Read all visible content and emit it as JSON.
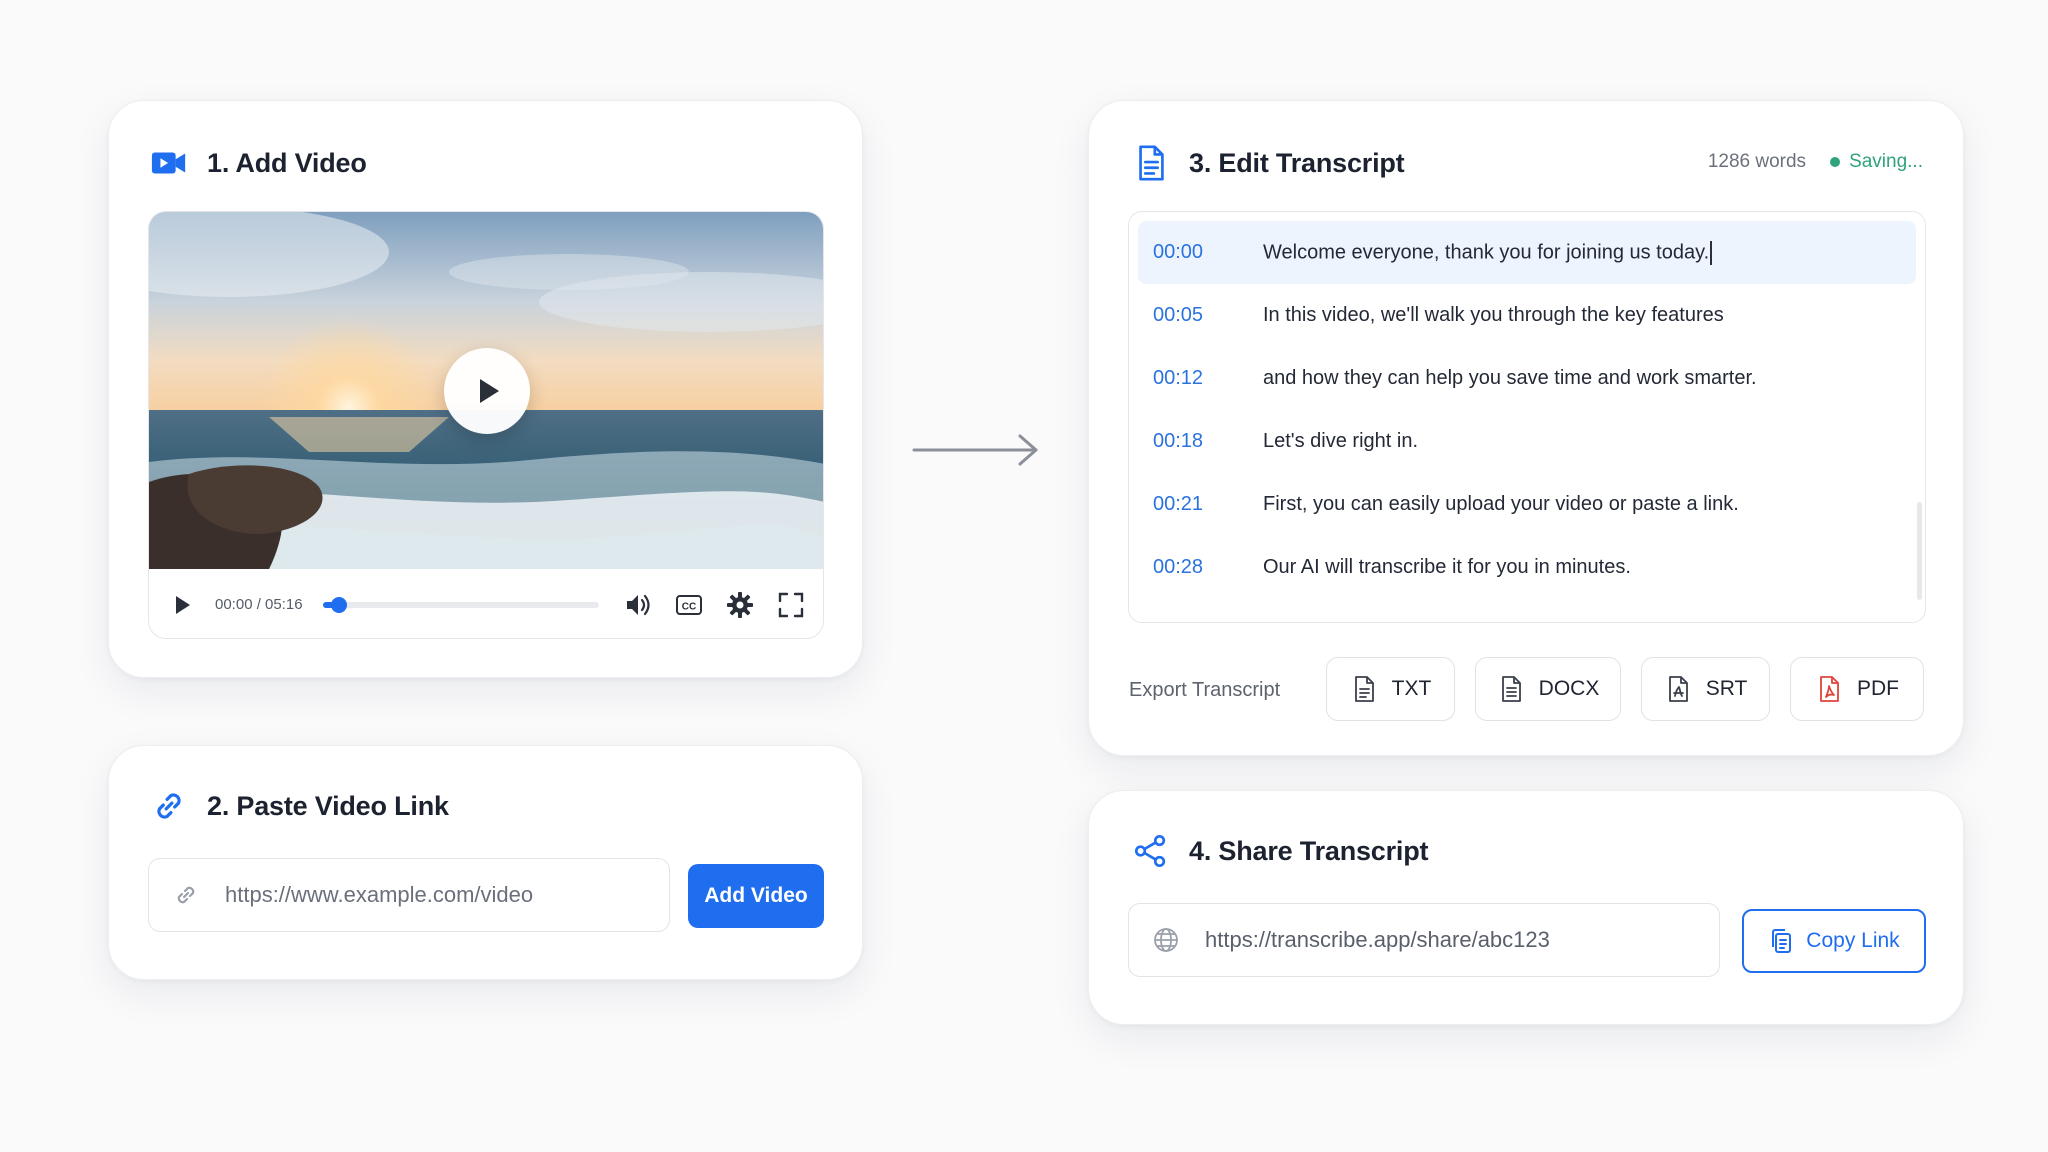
{
  "colors": {
    "accent": "#1f6ef0",
    "timestamp": "#2a72de",
    "saving_status": "#2fa37b",
    "pdf_icon": "#e0443a"
  },
  "add_video": {
    "title": "1. Add Video",
    "icon": "video-camera-icon",
    "player": {
      "time_readout": "00:00 / 05:16",
      "progress_fraction": 0.06,
      "controls": [
        "play-icon",
        "volume-icon",
        "captions-icon",
        "settings-icon",
        "fullscreen-icon"
      ]
    }
  },
  "paste_link": {
    "title": "2. Paste Video Link",
    "icon": "link-icon",
    "url_placeholder": "https://www.example.com/video",
    "button_label": "Add Video"
  },
  "edit_transcript": {
    "title": "3. Edit Transcript",
    "icon": "document-icon",
    "word_count": "1286 words",
    "status": "Saving...",
    "lines": [
      {
        "time": "00:00",
        "text": "Welcome everyone, thank you for joining us today.",
        "active": true
      },
      {
        "time": "00:05",
        "text": "In this video, we'll walk you through the key features"
      },
      {
        "time": "00:12",
        "text": "and how they can help you save time and work smarter."
      },
      {
        "time": "00:18",
        "text": "Let's dive right in."
      },
      {
        "time": "00:21",
        "text": "First, you can easily upload your video or paste a link."
      },
      {
        "time": "00:28",
        "text": "Our AI will transcribe it for you in minutes."
      }
    ],
    "export_label": "Export Transcript",
    "export_formats": [
      "TXT",
      "DOCX",
      "SRT",
      "PDF"
    ]
  },
  "share": {
    "title": "4. Share Transcript",
    "icon": "share-icon",
    "share_url": "https://transcribe.app/share/abc123",
    "button_label": "Copy Link"
  }
}
